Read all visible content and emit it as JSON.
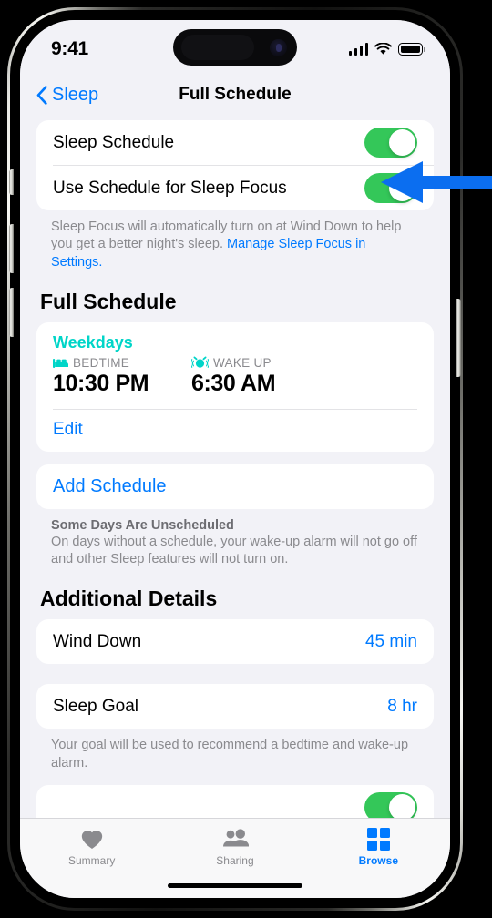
{
  "status_bar": {
    "time": "9:41",
    "signal_icon": "cellular-signal-icon",
    "wifi_icon": "wifi-icon",
    "battery_icon": "battery-icon"
  },
  "nav": {
    "back_label": "Sleep",
    "back_icon": "chevron-left-icon",
    "title": "Full Schedule"
  },
  "toggles_card": {
    "rows": [
      {
        "label": "Sleep Schedule",
        "state": "on"
      },
      {
        "label": "Use Schedule for Sleep Focus",
        "state": "on"
      }
    ],
    "footnote_text": "Sleep Focus will automatically turn on at Wind Down to help you get a better night's sleep. ",
    "footnote_link": "Manage Sleep Focus in Settings."
  },
  "full_schedule": {
    "header": "Full Schedule",
    "schedule": {
      "days": "Weekdays",
      "bedtime_icon": "bed-icon",
      "bedtime_label": "BEDTIME",
      "bedtime_value": "10:30 PM",
      "wakeup_icon": "alarm-clock-icon",
      "wakeup_label": "WAKE UP",
      "wakeup_value": "6:30 AM",
      "edit_label": "Edit"
    },
    "add_schedule_label": "Add Schedule",
    "unscheduled_title": "Some Days Are Unscheduled",
    "unscheduled_body": "On days without a schedule, your wake-up alarm will not go off and other Sleep features will not turn on."
  },
  "additional_details": {
    "header": "Additional Details",
    "wind_down": {
      "label": "Wind Down",
      "value": "45 min"
    },
    "sleep_goal": {
      "label": "Sleep Goal",
      "value": "8 hr"
    },
    "sleep_goal_footnote": "Your goal will be used to recommend a bedtime and wake-up alarm."
  },
  "tab_bar": {
    "tabs": [
      {
        "label": "Summary",
        "icon": "heart-icon",
        "active": false
      },
      {
        "label": "Sharing",
        "icon": "people-icon",
        "active": false
      },
      {
        "label": "Browse",
        "icon": "grid-icon",
        "active": true
      }
    ]
  },
  "annotation": {
    "arrow_icon": "left-arrow-annotation",
    "color": "#0b6ef0",
    "points_at": "Sleep Schedule toggle"
  },
  "colors": {
    "accent_blue": "#007aff",
    "toggle_green": "#34c759",
    "teal": "#00d5c8",
    "background": "#f2f2f7",
    "card": "#ffffff"
  }
}
